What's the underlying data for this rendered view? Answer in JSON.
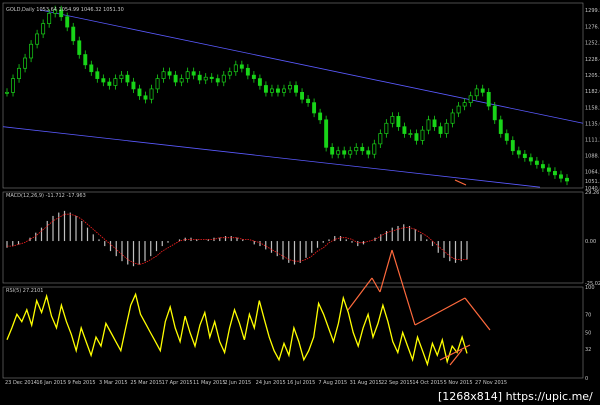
{
  "chart_data": [
    {
      "type": "line",
      "panel": "price",
      "title": "GOLD,Daily 1053.64 1054.99 1046.32 1051.30",
      "series": [
        {
          "name": "GOLD,Daily",
          "style": "candles",
          "color": "#19d419",
          "x_index": [
            0,
            5,
            10,
            15,
            20,
            25,
            30,
            35,
            40,
            45,
            50,
            55,
            60,
            65,
            70,
            75,
            80,
            85,
            90,
            95,
            100,
            105,
            110,
            115,
            120,
            125,
            130,
            135,
            140,
            145,
            150,
            155,
            160,
            165,
            170,
            175,
            180,
            185,
            190,
            195,
            200,
            205,
            210,
            215,
            220,
            225,
            230,
            235,
            240,
            245,
            250,
            255,
            260,
            265,
            270,
            275,
            280,
            285,
            290,
            295,
            300,
            305,
            310,
            315,
            320,
            325,
            330,
            335,
            340,
            345,
            350,
            355,
            360,
            365,
            370,
            375,
            380,
            385,
            390,
            395,
            400,
            405,
            410,
            415,
            420,
            425,
            430,
            435,
            440,
            445,
            450,
            455,
            460,
            465
          ],
          "values": [
            1180,
            1200,
            1215,
            1230,
            1250,
            1265,
            1280,
            1295,
            1300,
            1290,
            1275,
            1255,
            1235,
            1220,
            1210,
            1200,
            1195,
            1190,
            1200,
            1205,
            1195,
            1185,
            1175,
            1170,
            1185,
            1200,
            1210,
            1205,
            1195,
            1200,
            1210,
            1205,
            1198,
            1202,
            1200,
            1195,
            1205,
            1210,
            1220,
            1215,
            1205,
            1200,
            1190,
            1180,
            1185,
            1180,
            1185,
            1190,
            1180,
            1170,
            1165,
            1150,
            1140,
            1100,
            1090,
            1095,
            1090,
            1095,
            1100,
            1095,
            1090,
            1105,
            1120,
            1135,
            1145,
            1130,
            1120,
            1120,
            1110,
            1125,
            1140,
            1130,
            1120,
            1135,
            1150,
            1160,
            1165,
            1175,
            1185,
            1180,
            1160,
            1140,
            1120,
            1110,
            1095,
            1090,
            1085,
            1080,
            1075,
            1070,
            1065,
            1060,
            1055,
            1051
          ]
        }
      ],
      "ytick_labels": [
        "1299.5",
        "1276.1",
        "1252.2",
        "1228.4",
        "1205.2",
        "1182.0",
        "1158.2",
        "1135.0",
        "1111.2",
        "1088.1",
        "1064.5",
        "1051.3",
        "1040.8"
      ],
      "ylim": [
        1040.8,
        1310
      ]
    },
    {
      "type": "bar",
      "panel": "macd",
      "title": "MACD(12,26,9) -11.712 -17.963",
      "series": [
        {
          "name": "MACD histogram",
          "color": "#c0c0c0",
          "values": [
            -4,
            -3,
            -2,
            0,
            2,
            5,
            8,
            12,
            15,
            17,
            18,
            17,
            15,
            12,
            8,
            4,
            1,
            -3,
            -6,
            -9,
            -12,
            -14,
            -15,
            -14,
            -12,
            -9,
            -6,
            -3,
            -1,
            0,
            1,
            2,
            2,
            1,
            0,
            1,
            2,
            2,
            3,
            3,
            2,
            1,
            0,
            -2,
            -3,
            -5,
            -7,
            -9,
            -11,
            -13,
            -14,
            -13,
            -10,
            -7,
            -4,
            -1,
            1,
            3,
            3,
            1,
            -1,
            -3,
            -2,
            0,
            2,
            4,
            6,
            8,
            9,
            10,
            9,
            7,
            4,
            1,
            -3,
            -7,
            -10,
            -12,
            -13,
            -12,
            -11
          ]
        },
        {
          "name": "Signal",
          "color": "#ff2020",
          "values": [
            -3,
            -3,
            -2,
            -1,
            1,
            3,
            6,
            9,
            12,
            14,
            16,
            16,
            15,
            13,
            10,
            7,
            4,
            1,
            -2,
            -5,
            -8,
            -11,
            -13,
            -14,
            -13,
            -11,
            -9,
            -6,
            -4,
            -2,
            0,
            1,
            1,
            1,
            1,
            1,
            1,
            2,
            2,
            2,
            2,
            1,
            1,
            0,
            -1,
            -3,
            -5,
            -7,
            -9,
            -11,
            -12,
            -12,
            -11,
            -9,
            -6,
            -4,
            -1,
            1,
            2,
            2,
            1,
            -1,
            -1,
            0,
            1,
            3,
            5,
            6,
            7,
            8,
            8,
            7,
            5,
            3,
            0,
            -3,
            -6,
            -9,
            -11,
            -11,
            -11
          ]
        }
      ],
      "ytick_labels": [
        "29.267",
        "0.00",
        "-25.025"
      ],
      "ylim": [
        -25.025,
        29.267
      ]
    },
    {
      "type": "line",
      "panel": "rsi",
      "title": "RSI(5) 27.2101",
      "series": [
        {
          "name": "RSI(5)",
          "color": "#ffff00",
          "values": [
            42,
            55,
            70,
            62,
            75,
            58,
            85,
            72,
            90,
            68,
            55,
            80,
            62,
            48,
            30,
            55,
            40,
            25,
            45,
            35,
            60,
            50,
            40,
            30,
            55,
            80,
            92,
            70,
            60,
            50,
            40,
            30,
            62,
            78,
            55,
            40,
            68,
            50,
            35,
            58,
            72,
            45,
            62,
            40,
            28,
            55,
            75,
            60,
            42,
            70,
            55,
            85,
            65,
            45,
            30,
            20,
            38,
            25,
            55,
            40,
            20,
            30,
            45,
            82,
            70,
            55,
            40,
            60,
            88,
            72,
            50,
            35,
            55,
            70,
            45,
            60,
            80,
            62,
            40,
            28,
            50,
            35,
            20,
            45,
            30,
            15,
            38,
            25,
            42,
            18,
            35,
            28,
            45,
            27
          ]
        }
      ],
      "ytick_labels": [
        "100",
        "70",
        "50",
        "32",
        "0"
      ],
      "ylim": [
        0,
        100
      ]
    }
  ],
  "xtick_labels": [
    "23 Dec 2014",
    "16 Jan 2015",
    "9 Feb 2015",
    "3 Mar 2015",
    "25 Mar 2015",
    "17 Apr 2015",
    "11 May 2015",
    "2 Jun 2015",
    "24 Jun 2015",
    "16 Jul 2015",
    "7 Aug 2015",
    "31 Aug 2015",
    "22 Sep 2015",
    "14 Oct 2015",
    "5 Nov 2015",
    "27 Nov 2015"
  ],
  "colors": {
    "background": "#000000",
    "trendline": "#5a5aff",
    "annotation": "#ff6a3d",
    "axis": "#808080"
  },
  "watermark": "[1268x814] https://upic.me/"
}
